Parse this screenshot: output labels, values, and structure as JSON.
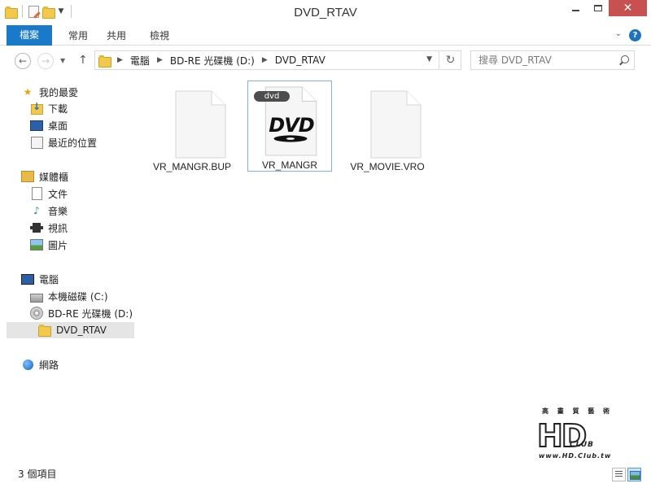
{
  "window": {
    "title": "DVD_RTAV"
  },
  "ribbon": {
    "tabs": [
      {
        "label": "檔案"
      },
      {
        "label": "常用"
      },
      {
        "label": "共用"
      },
      {
        "label": "檢視"
      }
    ],
    "accent": "#1979ca"
  },
  "address": {
    "crumbs": [
      "電腦",
      "BD-RE 光碟機 (D:)",
      "DVD_RTAV"
    ]
  },
  "search": {
    "placeholder": "搜尋 DVD_RTAV"
  },
  "sidebar": {
    "items": [
      {
        "label": "我的最愛",
        "icon": "star-icon"
      },
      {
        "label": "下載",
        "icon": "downloads-icon"
      },
      {
        "label": "桌面",
        "icon": "desktop-icon"
      },
      {
        "label": "最近的位置",
        "icon": "recent-places-icon"
      },
      {
        "label": "媒體櫃",
        "icon": "libraries-icon"
      },
      {
        "label": "文件",
        "icon": "documents-icon"
      },
      {
        "label": "音樂",
        "icon": "music-icon"
      },
      {
        "label": "視訊",
        "icon": "video-icon"
      },
      {
        "label": "圖片",
        "icon": "pictures-icon"
      },
      {
        "label": "電腦",
        "icon": "computer-icon"
      },
      {
        "label": "本機磁碟 (C:)",
        "icon": "local-disk-icon"
      },
      {
        "label": "BD-RE 光碟機 (D:)",
        "icon": "optical-drive-icon"
      },
      {
        "label": "DVD_RTAV",
        "icon": "folder-icon",
        "selected": true
      },
      {
        "label": "網路",
        "icon": "network-icon"
      }
    ]
  },
  "files": [
    {
      "name": "VR_MANGR.BUP",
      "icon": "blank-file-icon"
    },
    {
      "name": "VR_MANGR",
      "icon": "dvd-file-icon",
      "badge": "dvd",
      "logo": "DVD",
      "selected": true
    },
    {
      "name": "VR_MOVIE.VRO",
      "icon": "blank-file-icon"
    }
  ],
  "status": {
    "item_count": "3 個項目"
  },
  "watermark": {
    "small": "高 畫 質 藝 術",
    "big": "HD",
    "sub": "CLUB",
    "url": "www.HD.Club.tw"
  }
}
